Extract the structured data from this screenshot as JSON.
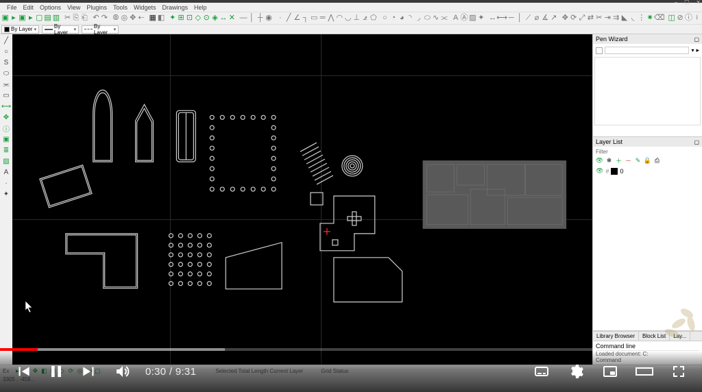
{
  "window": {
    "minimize": "−",
    "maximize": "☐",
    "close": "✕"
  },
  "menu": [
    "File",
    "Edit",
    "Options",
    "View",
    "Plugins",
    "Tools",
    "Widgets",
    "Drawings",
    "Help"
  ],
  "layer_selectors": [
    {
      "label": "By Layer"
    },
    {
      "label": "By Layer"
    },
    {
      "label": "By Layer"
    }
  ],
  "right": {
    "pen_wizard": {
      "title": "Pen Wizard"
    },
    "layer_list": {
      "title": "Layer List",
      "filter_label": "Filter",
      "active_layer": {
        "name": "0"
      }
    },
    "tabs": [
      "Library Browser",
      "Block List",
      "Lay..."
    ],
    "command": {
      "title": "Command line",
      "loaded": "Loaded document: C:",
      "prompt": "Command"
    }
  },
  "statusbar": {
    "left_tab": "Ex",
    "coords": "3305 , -459...",
    "selected": "Selected Total Length  Current Layer",
    "grid": "Grid Status"
  },
  "video": {
    "current": "0:30",
    "sep": " / ",
    "total": "9:31"
  }
}
